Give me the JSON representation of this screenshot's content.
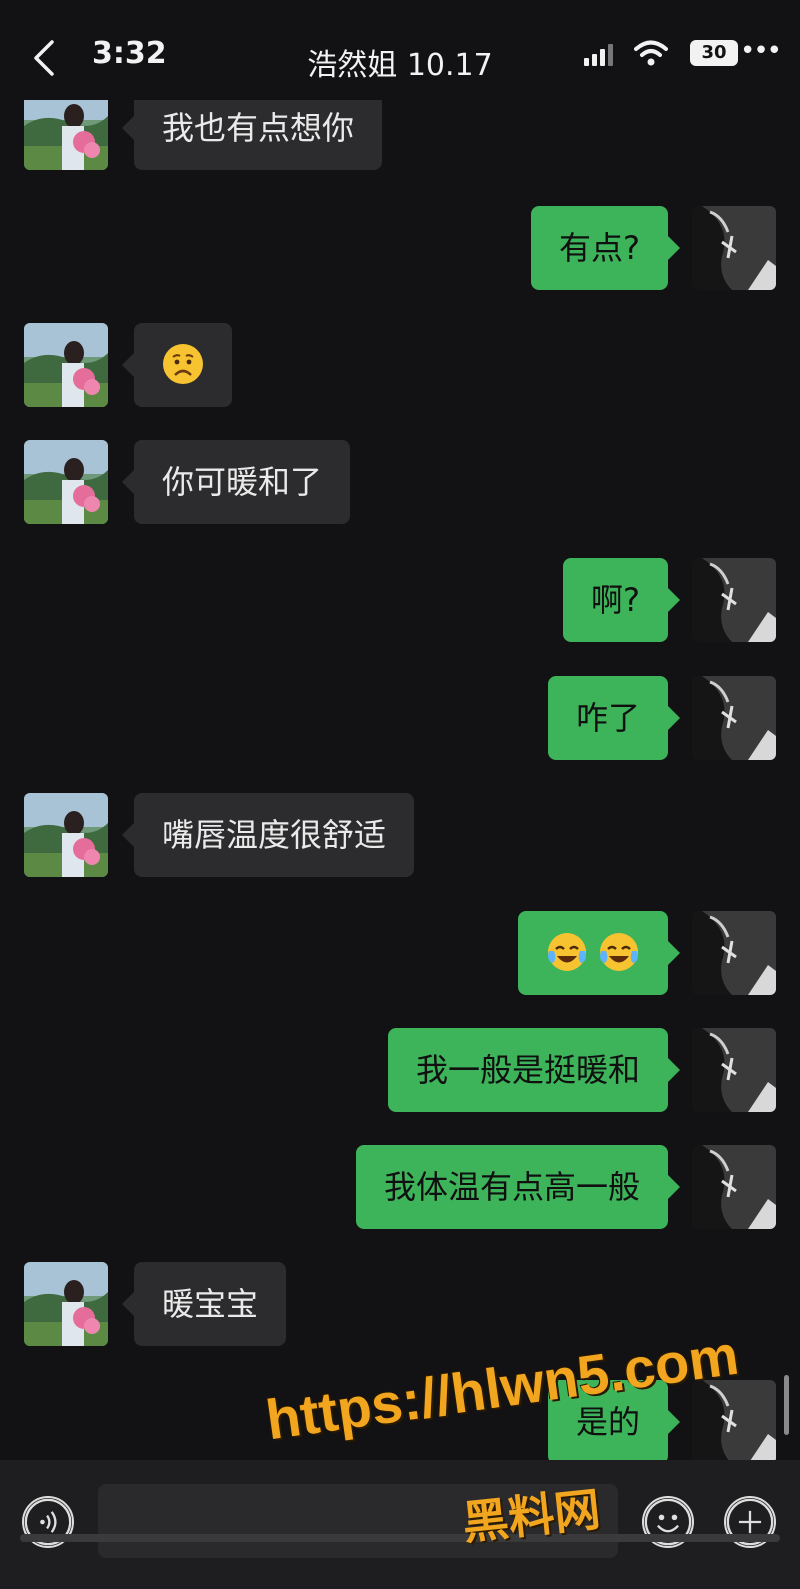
{
  "status_bar": {
    "time": "3:32",
    "battery": "30"
  },
  "header": {
    "title": "浩然姐 10.17"
  },
  "messages": [
    {
      "from": "her",
      "text": "我也有点想你"
    },
    {
      "from": "me",
      "text": "有点?"
    },
    {
      "from": "her",
      "text": "",
      "emoji": "worried-face"
    },
    {
      "from": "her",
      "text": "你可暖和了"
    },
    {
      "from": "me",
      "text": "啊?"
    },
    {
      "from": "me",
      "text": "咋了"
    },
    {
      "from": "her",
      "text": "嘴唇温度很舒适"
    },
    {
      "from": "me",
      "text": "",
      "emoji": "crying-laughing-face x2"
    },
    {
      "from": "me",
      "text": "我一般是挺暖和"
    },
    {
      "from": "me",
      "text": "我体温有点高一般"
    },
    {
      "from": "her",
      "text": "暖宝宝"
    },
    {
      "from": "me",
      "text": "是的"
    }
  ],
  "watermark": {
    "url": "https://hlwn5.com",
    "name": "黑料网"
  },
  "colors": {
    "background": "#121114",
    "my_bubble": "#3db35a",
    "her_bubble": "#2c2c2e",
    "watermark": "#f2a51e"
  }
}
